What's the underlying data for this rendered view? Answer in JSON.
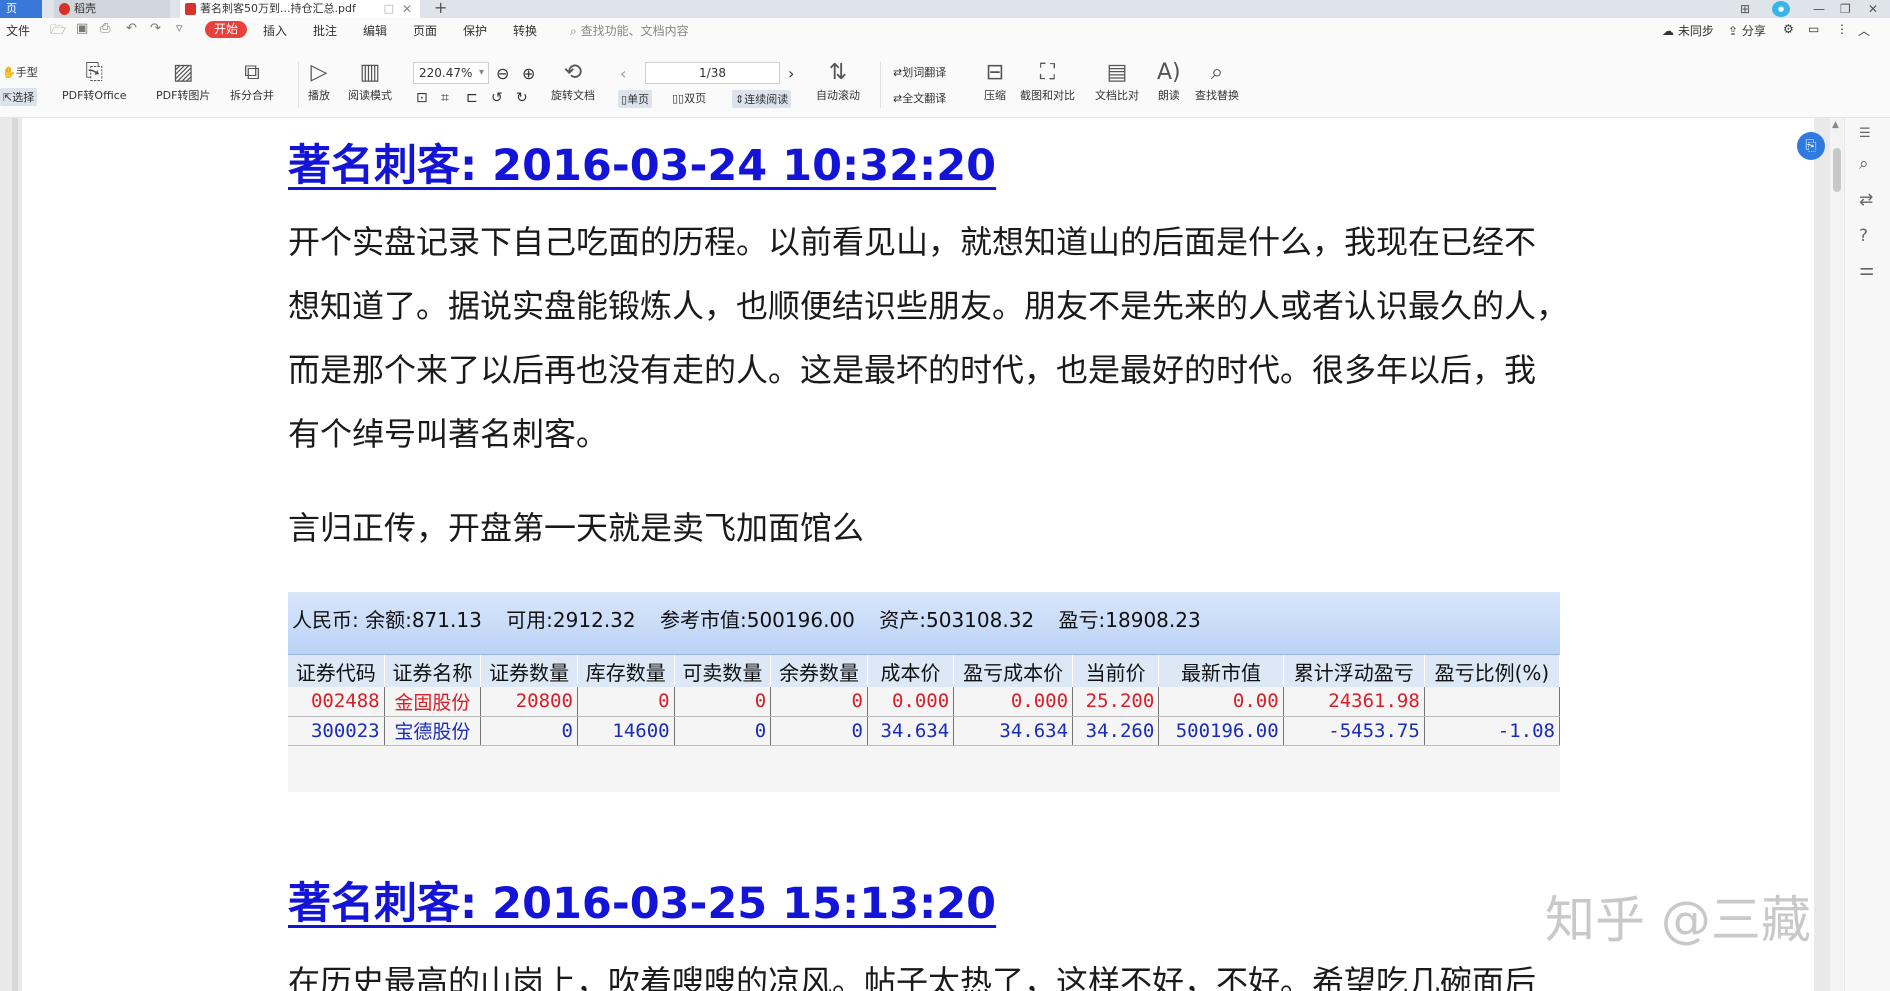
{
  "tabs": {
    "home": "页",
    "shell": "稻壳",
    "doc": "著名刺客50万到...持仓汇总.pdf",
    "new": "+"
  },
  "menu": {
    "file": "文件",
    "start": "开始",
    "items": [
      "插入",
      "批注",
      "编辑",
      "页面",
      "保护",
      "转换"
    ],
    "search": "查找功能、文档内容",
    "sync": "未同步",
    "share": "分享"
  },
  "ribbon": {
    "hand": "手型",
    "select": "选择",
    "pdf_to_office": "PDF转Office",
    "pdf_to_image": "PDF转图片",
    "split_merge": "拆分合并",
    "play": "播放",
    "read_mode": "阅读模式",
    "zoom": "220.47%",
    "rotate": "旋转文档",
    "page": "1/38",
    "single": "单页",
    "double": "双页",
    "continuous": "连续阅读",
    "autoscroll": "自动滚动",
    "word_translate": "划词翻译",
    "full_translate": "全文翻译",
    "compress": "压缩",
    "screenshot_compare": "截图和对比",
    "doc_compare": "文档比对",
    "read_aloud": "朗读",
    "find_replace": "查找替换"
  },
  "content": {
    "heading1": "著名刺客: 2016-03-24 10:32:20",
    "para1": [
      "开个实盘记录下自己吃面的历程。以前看见山，就想知道山的后面是什么，我现在已经不",
      "想知道了。据说实盘能锻炼人，也顺便结识些朋友。朋友不是先来的人或者认识最久的人，",
      "而是那个来了以后再也没有走的人。这是最坏的时代，也是最好的时代。很多年以后，我",
      "有个绰号叫著名刺客。"
    ],
    "para2": "言归正传，开盘第一天就是卖飞加面馆么",
    "heading2": "著名刺客: 2016-03-25 15:13:20",
    "para3": "在历史最高的山岗上，吹着嗖嗖的凉风。帖子太热了，这样不好，不好。希望吃几碗面后"
  },
  "holdings": {
    "summary": [
      "人民币: 余额:871.13",
      "可用:2912.32",
      "参考市值:500196.00",
      "资产:503108.32",
      "盈亏:18908.23"
    ],
    "columns": [
      "证券代码",
      "证券名称",
      "证券数量",
      "库存数量",
      "可卖数量",
      "余券数量",
      "成本价",
      "盈亏成本价",
      "当前价",
      "最新市值",
      "累计浮动盈亏",
      "盈亏比例(%)"
    ],
    "rows": [
      [
        "002488",
        "金固股份",
        "20800",
        "0",
        "0",
        "0",
        "0.000",
        "0.000",
        "25.200",
        "0.00",
        "24361.98",
        ""
      ],
      [
        "300023",
        "宝德股份",
        "0",
        "14600",
        "0",
        "0",
        "34.634",
        "34.634",
        "34.260",
        "500196.00",
        "-5453.75",
        "-1.08"
      ]
    ]
  },
  "watermark": "知乎 @三藏"
}
